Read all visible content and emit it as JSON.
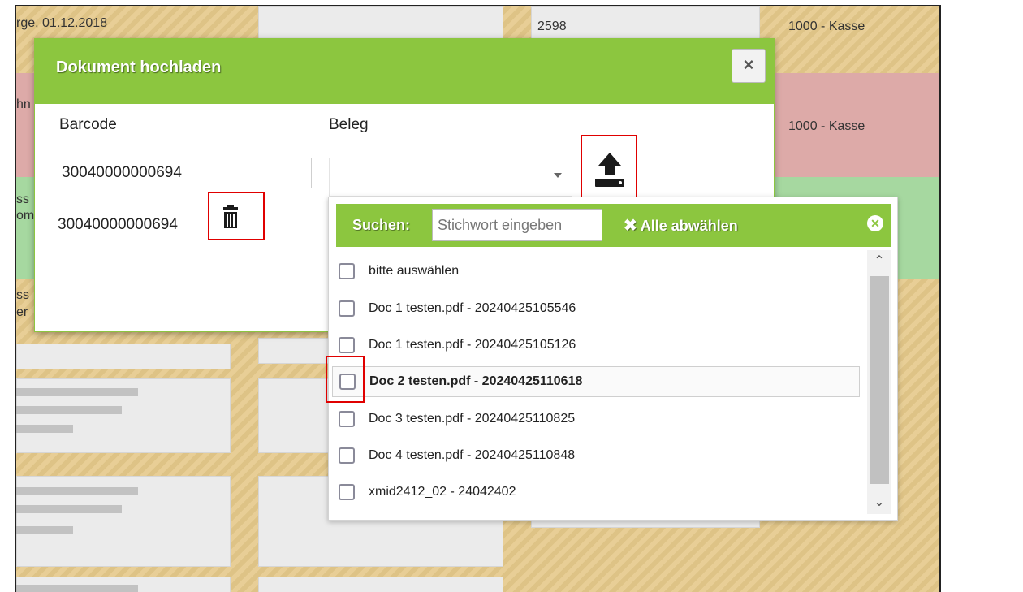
{
  "background": {
    "date_text": "rge, 01.12.2018",
    "number_text": "2598",
    "account_1": "1000 - Kasse",
    "account_2": "1000 - Kasse",
    "partial_1": "hn",
    "partial_2": "ss",
    "partial_3": "om",
    "partial_4": "ss",
    "partial_5": "er"
  },
  "dialog": {
    "title": "Dokument hochladen",
    "close_label": "×",
    "barcode_label": "Barcode",
    "beleg_label": "Beleg",
    "barcode_value": "30040000000694",
    "barcode_display": "30040000000694",
    "beleg_selected": ""
  },
  "dropdown": {
    "search_label": "Suchen:",
    "search_placeholder": "Stichwort eingeben",
    "deselect_all": "Alle abwählen",
    "items": [
      {
        "label": "bitte auswählen",
        "checked": false
      },
      {
        "label": "Doc 1 testen.pdf - 20240425105546",
        "checked": false
      },
      {
        "label": "Doc 1 testen.pdf - 20240425105126",
        "checked": false
      },
      {
        "label": "Doc 2 testen.pdf - 20240425110618",
        "checked": false,
        "highlighted": true
      },
      {
        "label": "Doc 3 testen.pdf - 20240425110825",
        "checked": false
      },
      {
        "label": "Doc 4 testen.pdf - 20240425110848",
        "checked": false
      },
      {
        "label": "xmid2412_02 - 24042402",
        "checked": false
      }
    ]
  },
  "icons": {
    "trash": "trash-icon",
    "upload": "upload-icon"
  },
  "colors": {
    "accent_green": "#8cc63f",
    "highlight_red": "#e00000"
  }
}
